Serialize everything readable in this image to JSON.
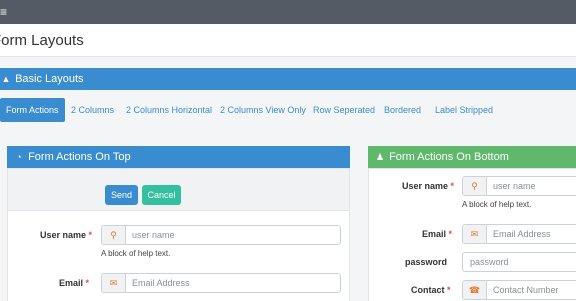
{
  "topbar": {
    "menu_icon": "menu-icon",
    "menu_glyph": "≡"
  },
  "page": {
    "title": "Form Layouts"
  },
  "basic_panel": {
    "title": "Basic Layouts",
    "icon": "bell-icon",
    "icon_glyph": "▲"
  },
  "tabs": [
    {
      "label": "Form Actions",
      "active": true
    },
    {
      "label": "2 Columns",
      "active": false
    },
    {
      "label": "2 Columns Horizontal",
      "active": false
    },
    {
      "label": "2 Columns View Only",
      "active": false
    },
    {
      "label": "Row Seperated",
      "active": false
    },
    {
      "label": "Bordered",
      "active": false
    },
    {
      "label": "Label Stripped",
      "active": false
    }
  ],
  "form_top": {
    "title": "Form Actions On Top",
    "icon": "pie-chart-icon",
    "icon_glyph": "◔",
    "send_label": "Send",
    "cancel_label": "Cancel",
    "username": {
      "label": "User name",
      "required": "*",
      "placeholder": "user name",
      "icon": "user-icon",
      "icon_glyph": "⚲",
      "help": "A block of help text."
    },
    "email": {
      "label": "Email",
      "required": "*",
      "placeholder": "Email Address",
      "icon": "envelope-icon",
      "icon_glyph": "✉"
    }
  },
  "form_bottom": {
    "title": "Form Actions On Bottom",
    "icon": "person-icon",
    "icon_glyph": "♟",
    "username": {
      "label": "User name",
      "required": "*",
      "placeholder": "user name",
      "icon": "user-icon",
      "icon_glyph": "⚲",
      "help": "A block of help text."
    },
    "email": {
      "label": "Email",
      "required": "*",
      "placeholder": "Email Address",
      "icon": "envelope-icon",
      "icon_glyph": "✉"
    },
    "password": {
      "label": "password",
      "placeholder": "password"
    },
    "contact": {
      "label": "Contact",
      "required": "*",
      "placeholder": "Contact Number",
      "icon": "phone-icon",
      "icon_glyph": "☎"
    }
  },
  "colors": {
    "primary": "#3a8cd0",
    "success": "#5fb86c",
    "teal": "#34c0a0",
    "required": "#d9534f",
    "topbar": "#545b65"
  }
}
